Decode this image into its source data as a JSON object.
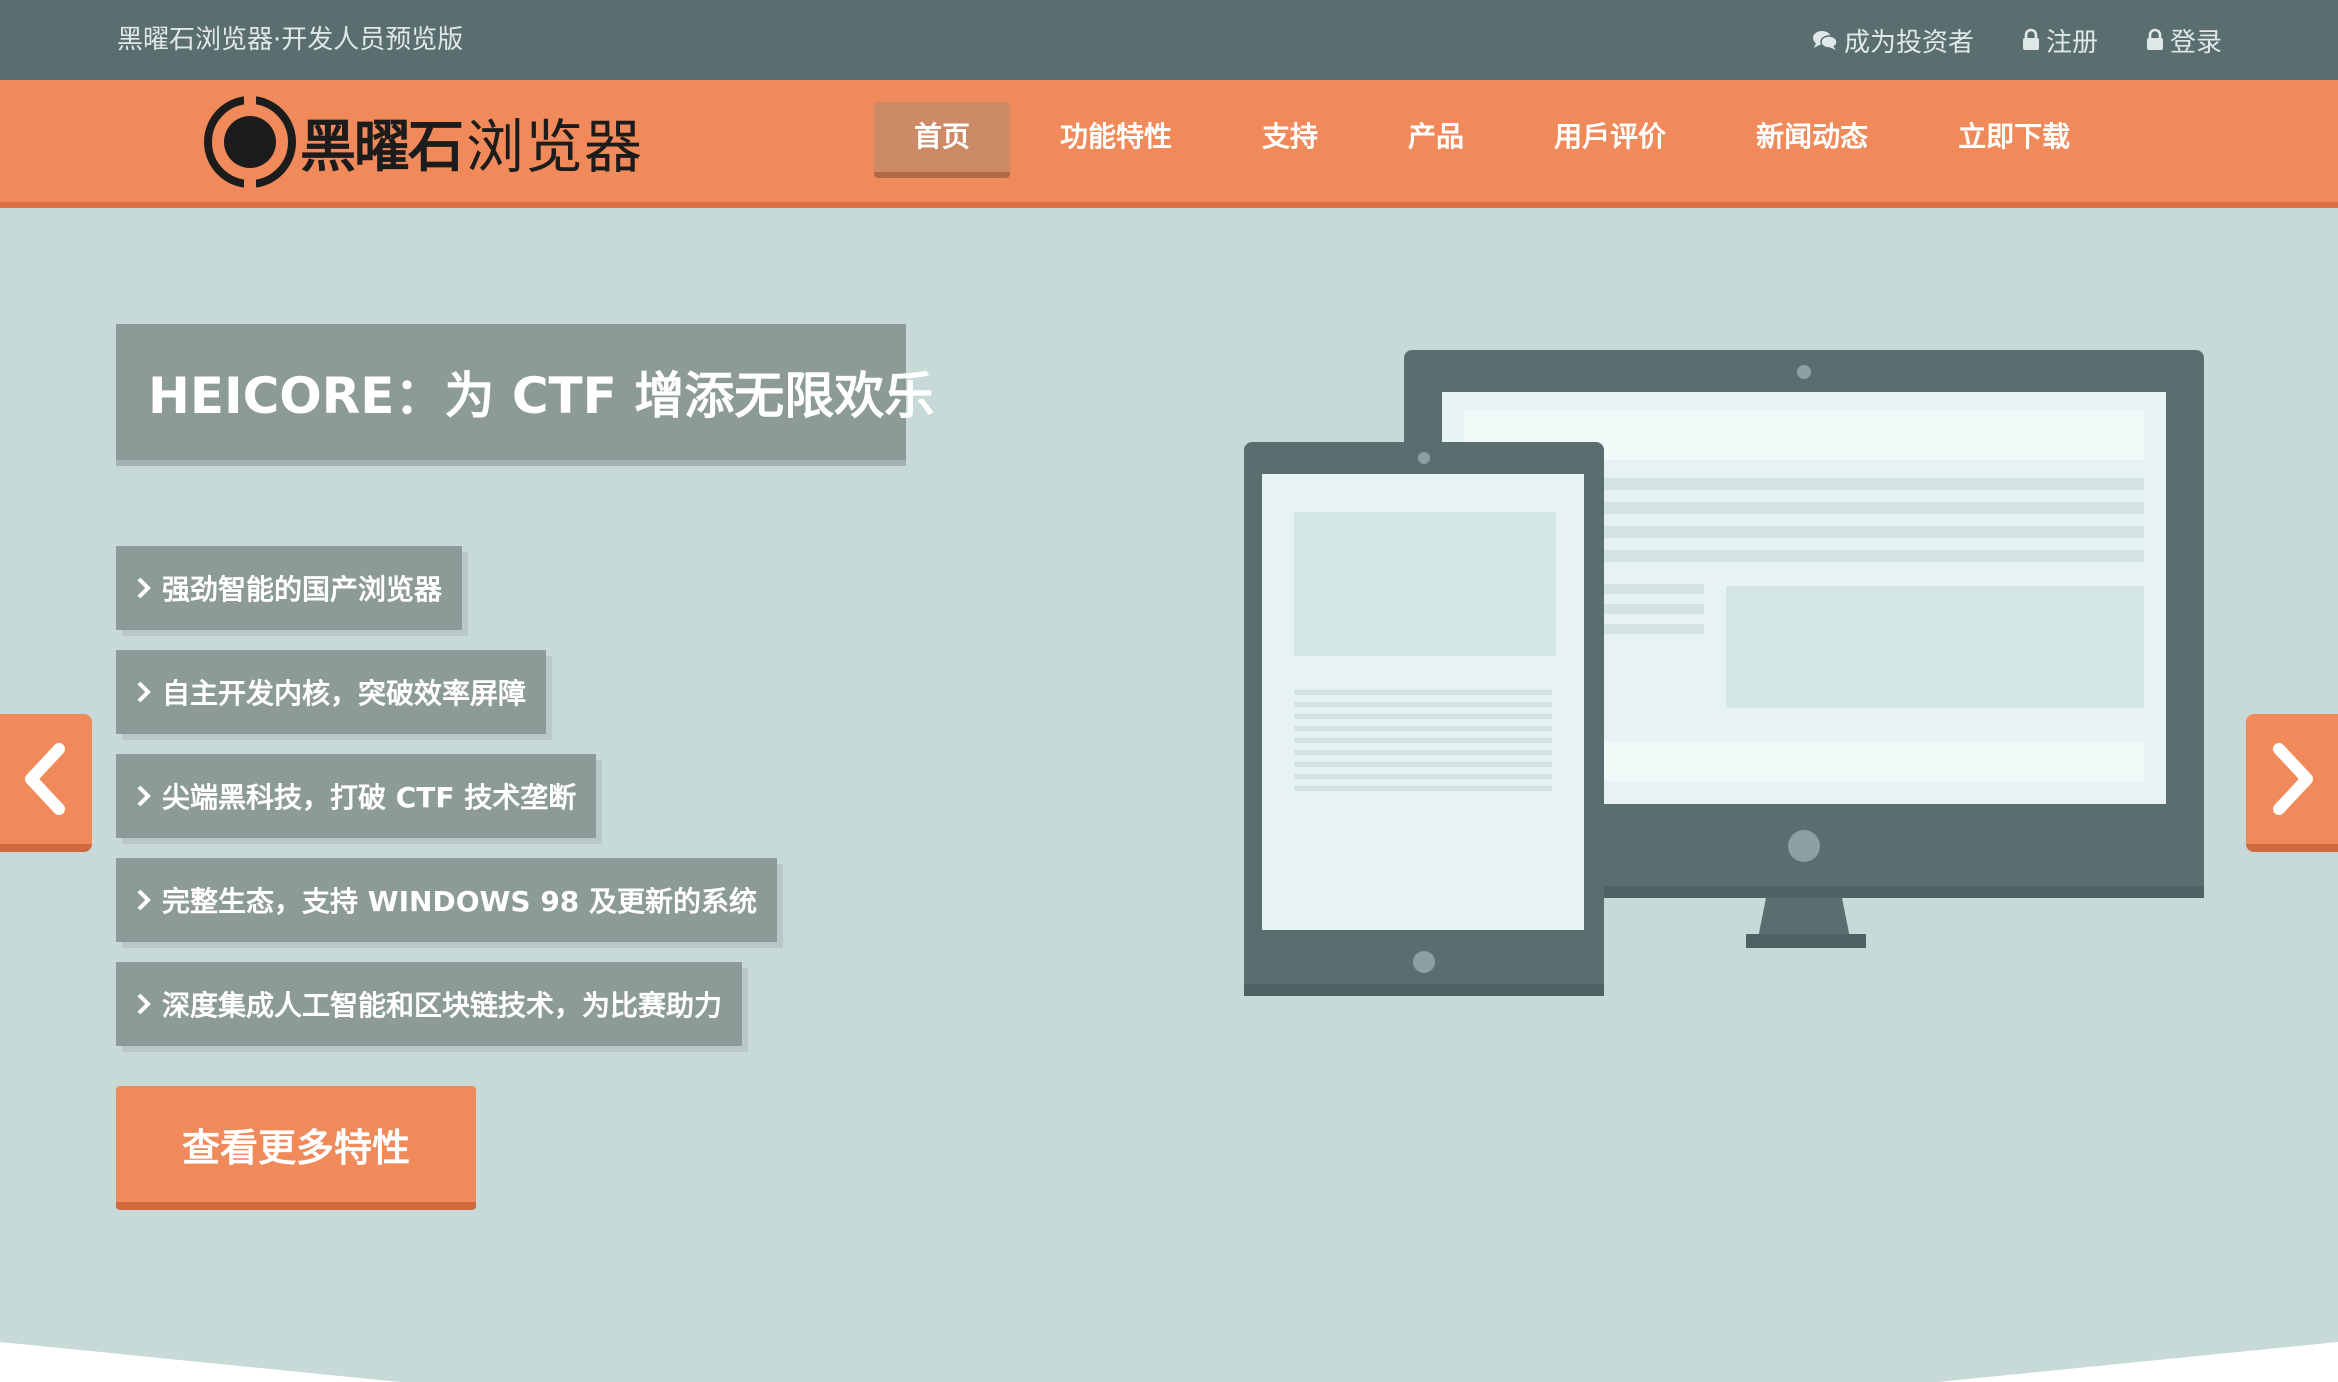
{
  "topbar": {
    "site_note": "黑曜石浏览器·开发人员预览版",
    "links": [
      {
        "label": "成为投资者",
        "icon": "chat-bubbles-icon"
      },
      {
        "label": "注册",
        "icon": "lock-icon"
      },
      {
        "label": "登录",
        "icon": "lock-icon"
      }
    ]
  },
  "logo": {
    "bold_text": "黑曜石",
    "light_text": "浏览器"
  },
  "nav": {
    "items": [
      "首页",
      "功能特性",
      "支持",
      "产品",
      "用戶评价",
      "新闻动态",
      "立即下载"
    ],
    "active_index": 0
  },
  "hero": {
    "title": "HEICORE：为 CTF 增添无限欢乐",
    "features": [
      "强劲智能的国产浏览器",
      "自主开发内核，突破效率屏障",
      "尖端黑科技，打破 CTF 技术垄断",
      "完整生态，支持 WINDOWS 98 及更新的系统",
      "深度集成人工智能和区块链技术，为比赛助力"
    ],
    "cta_label": "查看更多特性"
  },
  "colors": {
    "topbar": "#5a6e70",
    "accent": "#f18a5a",
    "hero_bg": "#c8dad8",
    "feature_bg": "#8c9a98",
    "device": "#5a6e70"
  },
  "carousel": {
    "prev_icon": "chevron-left-icon",
    "next_icon": "chevron-right-icon"
  }
}
